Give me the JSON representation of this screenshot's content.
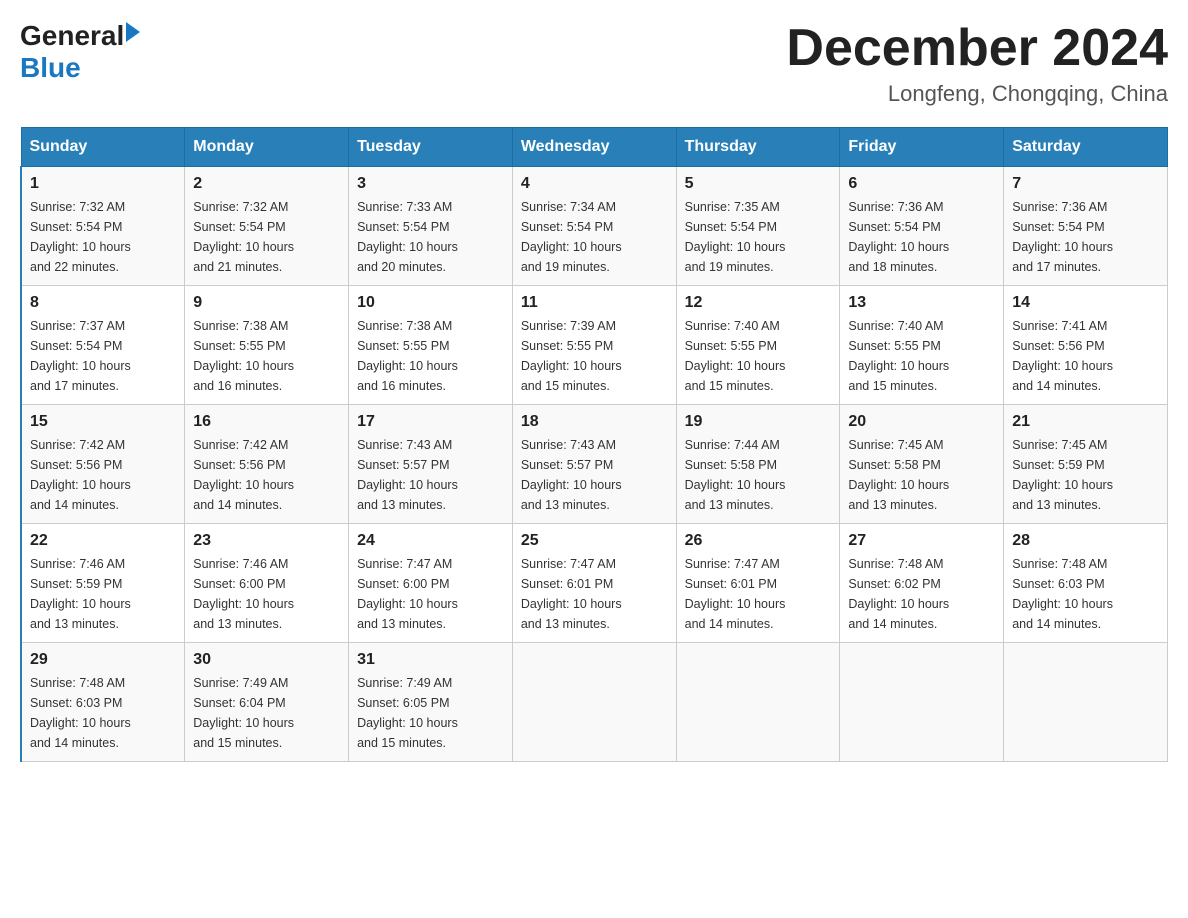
{
  "header": {
    "logo_general": "General",
    "logo_arrow": "▶",
    "logo_blue": "Blue",
    "month_title": "December 2024",
    "location": "Longfeng, Chongqing, China"
  },
  "days_of_week": [
    "Sunday",
    "Monday",
    "Tuesday",
    "Wednesday",
    "Thursday",
    "Friday",
    "Saturday"
  ],
  "weeks": [
    [
      {
        "day": "1",
        "sunrise": "7:32 AM",
        "sunset": "5:54 PM",
        "daylight": "10 hours and 22 minutes."
      },
      {
        "day": "2",
        "sunrise": "7:32 AM",
        "sunset": "5:54 PM",
        "daylight": "10 hours and 21 minutes."
      },
      {
        "day": "3",
        "sunrise": "7:33 AM",
        "sunset": "5:54 PM",
        "daylight": "10 hours and 20 minutes."
      },
      {
        "day": "4",
        "sunrise": "7:34 AM",
        "sunset": "5:54 PM",
        "daylight": "10 hours and 19 minutes."
      },
      {
        "day": "5",
        "sunrise": "7:35 AM",
        "sunset": "5:54 PM",
        "daylight": "10 hours and 19 minutes."
      },
      {
        "day": "6",
        "sunrise": "7:36 AM",
        "sunset": "5:54 PM",
        "daylight": "10 hours and 18 minutes."
      },
      {
        "day": "7",
        "sunrise": "7:36 AM",
        "sunset": "5:54 PM",
        "daylight": "10 hours and 17 minutes."
      }
    ],
    [
      {
        "day": "8",
        "sunrise": "7:37 AM",
        "sunset": "5:54 PM",
        "daylight": "10 hours and 17 minutes."
      },
      {
        "day": "9",
        "sunrise": "7:38 AM",
        "sunset": "5:55 PM",
        "daylight": "10 hours and 16 minutes."
      },
      {
        "day": "10",
        "sunrise": "7:38 AM",
        "sunset": "5:55 PM",
        "daylight": "10 hours and 16 minutes."
      },
      {
        "day": "11",
        "sunrise": "7:39 AM",
        "sunset": "5:55 PM",
        "daylight": "10 hours and 15 minutes."
      },
      {
        "day": "12",
        "sunrise": "7:40 AM",
        "sunset": "5:55 PM",
        "daylight": "10 hours and 15 minutes."
      },
      {
        "day": "13",
        "sunrise": "7:40 AM",
        "sunset": "5:55 PM",
        "daylight": "10 hours and 15 minutes."
      },
      {
        "day": "14",
        "sunrise": "7:41 AM",
        "sunset": "5:56 PM",
        "daylight": "10 hours and 14 minutes."
      }
    ],
    [
      {
        "day": "15",
        "sunrise": "7:42 AM",
        "sunset": "5:56 PM",
        "daylight": "10 hours and 14 minutes."
      },
      {
        "day": "16",
        "sunrise": "7:42 AM",
        "sunset": "5:56 PM",
        "daylight": "10 hours and 14 minutes."
      },
      {
        "day": "17",
        "sunrise": "7:43 AM",
        "sunset": "5:57 PM",
        "daylight": "10 hours and 13 minutes."
      },
      {
        "day": "18",
        "sunrise": "7:43 AM",
        "sunset": "5:57 PM",
        "daylight": "10 hours and 13 minutes."
      },
      {
        "day": "19",
        "sunrise": "7:44 AM",
        "sunset": "5:58 PM",
        "daylight": "10 hours and 13 minutes."
      },
      {
        "day": "20",
        "sunrise": "7:45 AM",
        "sunset": "5:58 PM",
        "daylight": "10 hours and 13 minutes."
      },
      {
        "day": "21",
        "sunrise": "7:45 AM",
        "sunset": "5:59 PM",
        "daylight": "10 hours and 13 minutes."
      }
    ],
    [
      {
        "day": "22",
        "sunrise": "7:46 AM",
        "sunset": "5:59 PM",
        "daylight": "10 hours and 13 minutes."
      },
      {
        "day": "23",
        "sunrise": "7:46 AM",
        "sunset": "6:00 PM",
        "daylight": "10 hours and 13 minutes."
      },
      {
        "day": "24",
        "sunrise": "7:47 AM",
        "sunset": "6:00 PM",
        "daylight": "10 hours and 13 minutes."
      },
      {
        "day": "25",
        "sunrise": "7:47 AM",
        "sunset": "6:01 PM",
        "daylight": "10 hours and 13 minutes."
      },
      {
        "day": "26",
        "sunrise": "7:47 AM",
        "sunset": "6:01 PM",
        "daylight": "10 hours and 14 minutes."
      },
      {
        "day": "27",
        "sunrise": "7:48 AM",
        "sunset": "6:02 PM",
        "daylight": "10 hours and 14 minutes."
      },
      {
        "day": "28",
        "sunrise": "7:48 AM",
        "sunset": "6:03 PM",
        "daylight": "10 hours and 14 minutes."
      }
    ],
    [
      {
        "day": "29",
        "sunrise": "7:48 AM",
        "sunset": "6:03 PM",
        "daylight": "10 hours and 14 minutes."
      },
      {
        "day": "30",
        "sunrise": "7:49 AM",
        "sunset": "6:04 PM",
        "daylight": "10 hours and 15 minutes."
      },
      {
        "day": "31",
        "sunrise": "7:49 AM",
        "sunset": "6:05 PM",
        "daylight": "10 hours and 15 minutes."
      },
      null,
      null,
      null,
      null
    ]
  ],
  "labels": {
    "sunrise": "Sunrise:",
    "sunset": "Sunset:",
    "daylight": "Daylight:"
  }
}
